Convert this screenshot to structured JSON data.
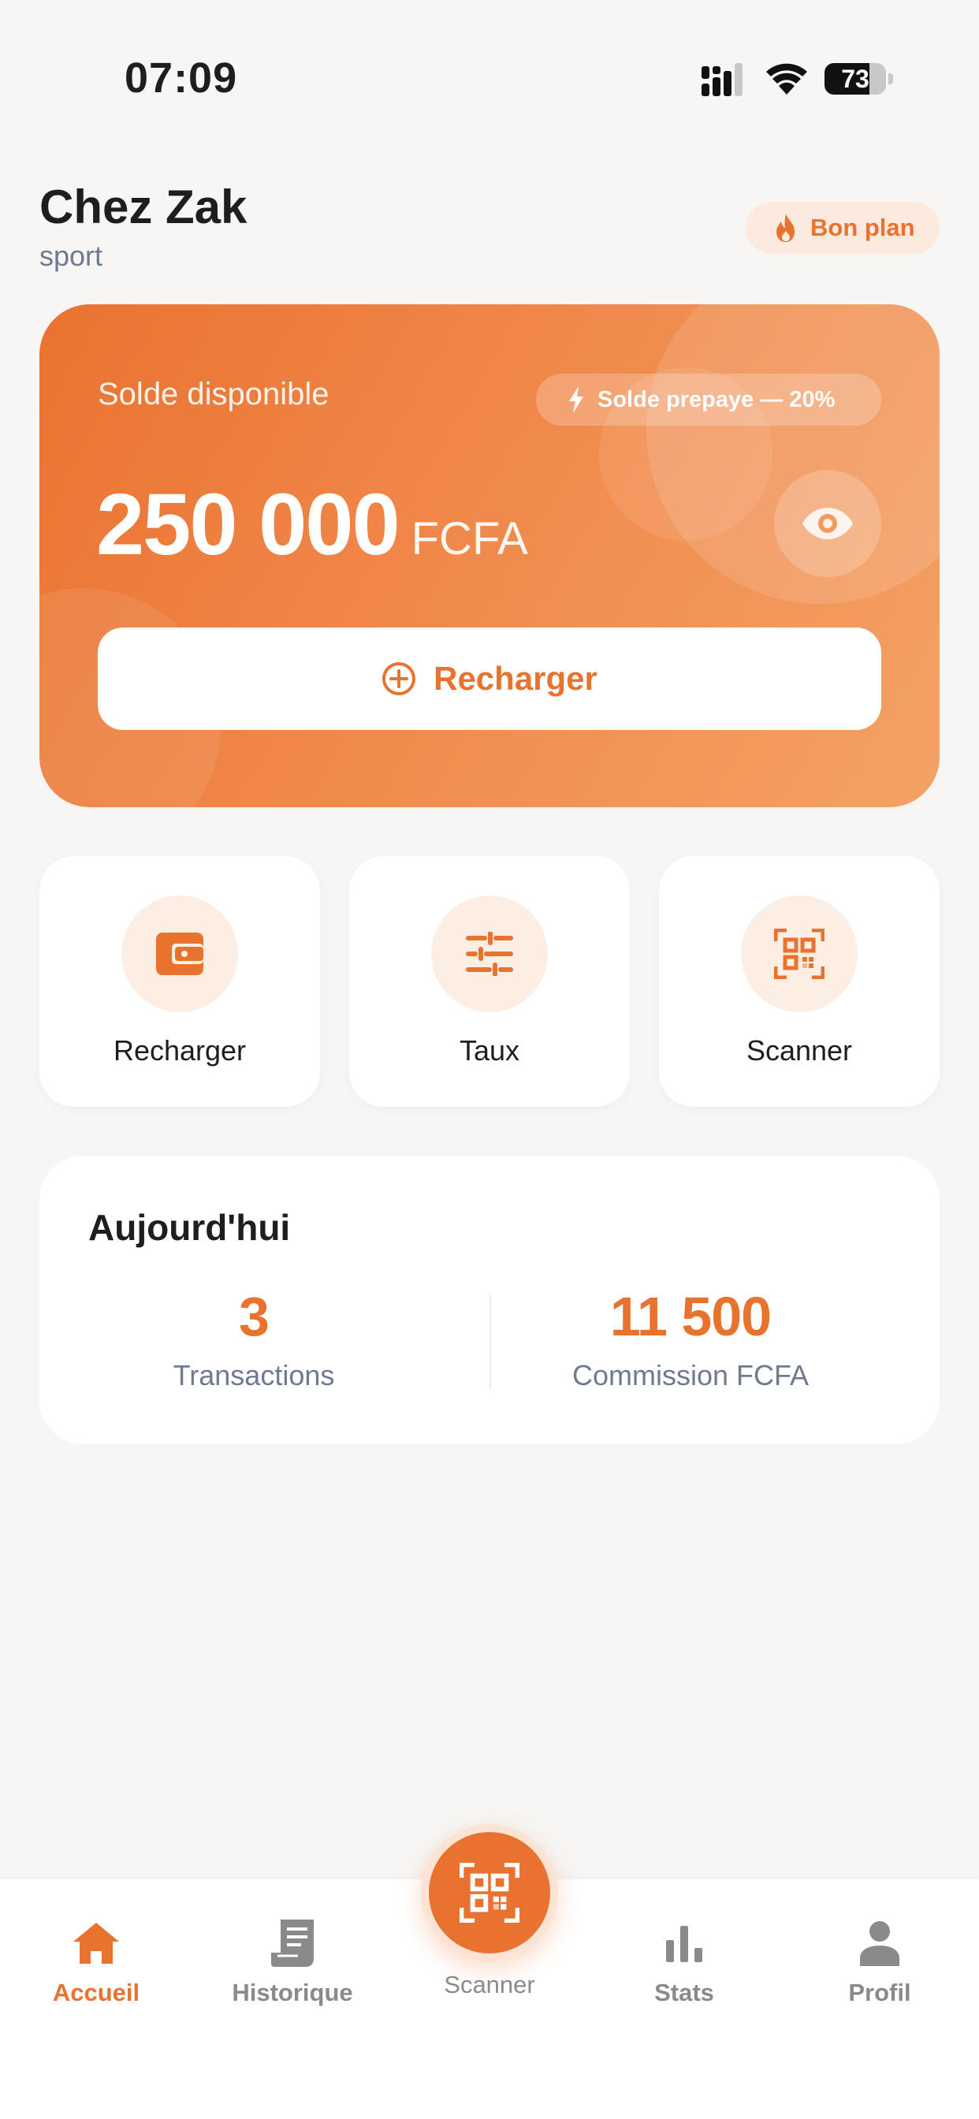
{
  "status_bar": {
    "time": "07:09",
    "battery_label": "73",
    "battery_level": 0.73
  },
  "header": {
    "merchant_name": "Chez Zak",
    "category": "sport",
    "badge_label": "Bon plan",
    "badge_icon": "flame-icon"
  },
  "balance": {
    "label": "Solde disponible",
    "plan_chip": "Solde prepaye — 20%",
    "plan_chip_icon": "bolt-icon",
    "amount": "250 000",
    "currency": "FCFA",
    "toggle_icon": "eye-icon",
    "recharge_label": "Recharger",
    "recharge_icon": "plus-circle-icon"
  },
  "actions": [
    {
      "label": "Recharger",
      "icon": "wallet-icon"
    },
    {
      "label": "Taux",
      "icon": "sliders-icon"
    },
    {
      "label": "Scanner",
      "icon": "qr-code-icon"
    }
  ],
  "today": {
    "title": "Aujourd'hui",
    "stats": [
      {
        "value": "3",
        "label": "Transactions"
      },
      {
        "value": "11 500",
        "label": "Commission FCFA"
      }
    ]
  },
  "nav": {
    "items": [
      {
        "label": "Accueil",
        "icon": "home-icon",
        "active": true
      },
      {
        "label": "Historique",
        "icon": "receipt-icon",
        "active": false
      },
      {
        "label": "Scanner",
        "icon": "qr-code-icon",
        "active": false
      },
      {
        "label": "Stats",
        "icon": "bar-chart-icon",
        "active": false
      },
      {
        "label": "Profil",
        "icon": "user-icon",
        "active": false
      }
    ]
  },
  "colors": {
    "accent": "#e8732f",
    "background": "#f7f6f4",
    "muted_text": "#6f7a90",
    "icon_bg": "#fdeee4"
  }
}
